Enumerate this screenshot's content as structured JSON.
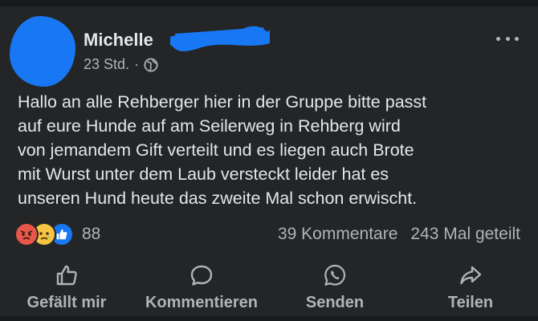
{
  "post": {
    "author": "Michelle",
    "time": "23 Std.",
    "separator": "·",
    "audience_icon": "globe-icon",
    "text": "Hallo an alle Rehberger hier in der Gruppe bitte passt\nauf eure Hunde auf am Seilerweg in Rehberg wird\nvon jemandem Gift verteilt und es liegen auch Brote\nmit Wurst unter dem Laub versteckt leider hat es\nunseren Hund heute das zweite Mal schon erwischt."
  },
  "reactions": {
    "icons": [
      "angry-reaction-icon",
      "sad-reaction-icon",
      "like-reaction-icon"
    ],
    "count": "88"
  },
  "stats": {
    "comments": "39 Kommentare",
    "shares": "243 Mal geteilt"
  },
  "actions": {
    "like": "Gefällt mir",
    "comment": "Kommentieren",
    "send": "Senden",
    "share": "Teilen"
  },
  "colors": {
    "background": "#242526",
    "text": "#e4e6eb",
    "secondary_text": "#b0b3b8",
    "redaction_blue": "#1877f2"
  }
}
